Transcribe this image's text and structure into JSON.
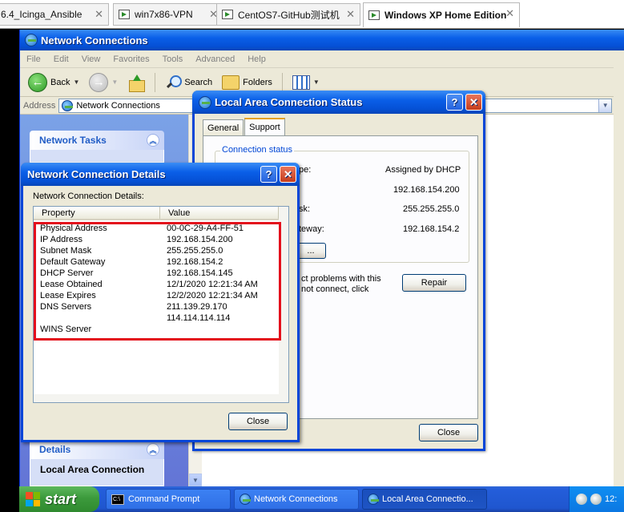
{
  "host_tabs": [
    {
      "label": "6.4_Icinga_Ansible",
      "active": false
    },
    {
      "label": "win7x86-VPN",
      "active": false
    },
    {
      "label": "CentOS7-GitHub测试机",
      "active": false
    },
    {
      "label": "Windows XP Home Edition",
      "active": true
    }
  ],
  "explorer": {
    "title": "Network Connections",
    "menu": [
      "File",
      "Edit",
      "View",
      "Favorites",
      "Tools",
      "Advanced",
      "Help"
    ],
    "toolbar": {
      "back": "Back",
      "search": "Search",
      "folders": "Folders"
    },
    "address_label": "Address",
    "address_value": "Network Connections",
    "network_tasks": "Network Tasks",
    "details": "Details",
    "lac_label": "Local Area Connection"
  },
  "status_dialog": {
    "title": "Local Area Connection Status",
    "tabs": [
      {
        "label": "General",
        "active": false
      },
      {
        "label": "Support",
        "active": true
      }
    ],
    "group_label": "Connection status",
    "rows": [
      {
        "label_tail": "pe:",
        "value": "Assigned by DHCP"
      },
      {
        "label_tail": "",
        "value": "192.168.154.200"
      },
      {
        "label_tail": "sk:",
        "value": "255.255.255.0"
      },
      {
        "label_tail": "teway:",
        "value": "192.168.154.2"
      }
    ],
    "details_btn": "...",
    "repair_text_1": "ct problems with this",
    "repair_text_2": "not connect, click",
    "repair_btn": "Repair",
    "close_btn": "Close"
  },
  "details_dialog": {
    "title": "Network Connection Details",
    "label": "Network Connection Details:",
    "col_property": "Property",
    "col_value": "Value",
    "rows": [
      {
        "property": "Physical Address",
        "value": "00-0C-29-A4-FF-51"
      },
      {
        "property": "IP Address",
        "value": "192.168.154.200"
      },
      {
        "property": "Subnet Mask",
        "value": "255.255.255.0"
      },
      {
        "property": "Default Gateway",
        "value": "192.168.154.2"
      },
      {
        "property": "DHCP Server",
        "value": "192.168.154.145"
      },
      {
        "property": "Lease Obtained",
        "value": "12/1/2020 12:21:34 AM"
      },
      {
        "property": "Lease Expires",
        "value": "12/2/2020 12:21:34 AM"
      },
      {
        "property": "DNS Servers",
        "value": "211.139.29.170"
      },
      {
        "property": "",
        "value": "114.114.114.114"
      },
      {
        "property": "WINS Server",
        "value": ""
      }
    ],
    "close_btn": "Close"
  },
  "taskbar": {
    "start": "start",
    "buttons": [
      {
        "label": "Command Prompt",
        "active": false
      },
      {
        "label": "Network Connections",
        "active": false
      },
      {
        "label": "Local Area Connectio...",
        "active": true
      }
    ],
    "clock": "12:"
  },
  "colors": {
    "xp_blue": "#0a5fe8",
    "highlight_red": "#e3101c",
    "start_green": "#3c9a3c"
  }
}
